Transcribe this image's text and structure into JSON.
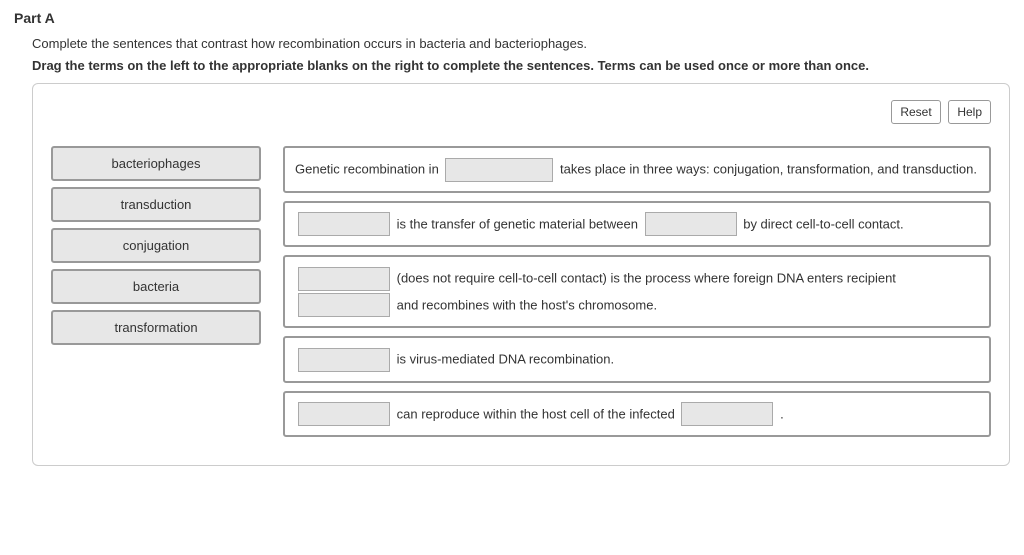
{
  "header": {
    "part_label": "Part A",
    "instruction_line1": "Complete the sentences that contrast how recombination occurs in bacteria and bacteriophages.",
    "instruction_line2": "Drag the terms on the left to the appropriate blanks on the right to complete the sentences. Terms can be used once or more than once."
  },
  "buttons": {
    "reset": "Reset",
    "help": "Help"
  },
  "terms": [
    "bacteriophages",
    "transduction",
    "conjugation",
    "bacteria",
    "transformation"
  ],
  "sentences": {
    "s1a": "Genetic recombination in ",
    "s1b": " takes place in three ways: conjugation, transformation, and transduction.",
    "s2b": " is the transfer of genetic material between ",
    "s2c": " by direct cell-to-cell contact.",
    "s3b": " (does not require cell-to-cell contact) is the process where foreign DNA enters recipient ",
    "s3c": " and recombines with the host's chromosome.",
    "s4b": " is virus-mediated DNA recombination.",
    "s5b": " can reproduce within the host cell of the infected ",
    "s5c": " ."
  }
}
